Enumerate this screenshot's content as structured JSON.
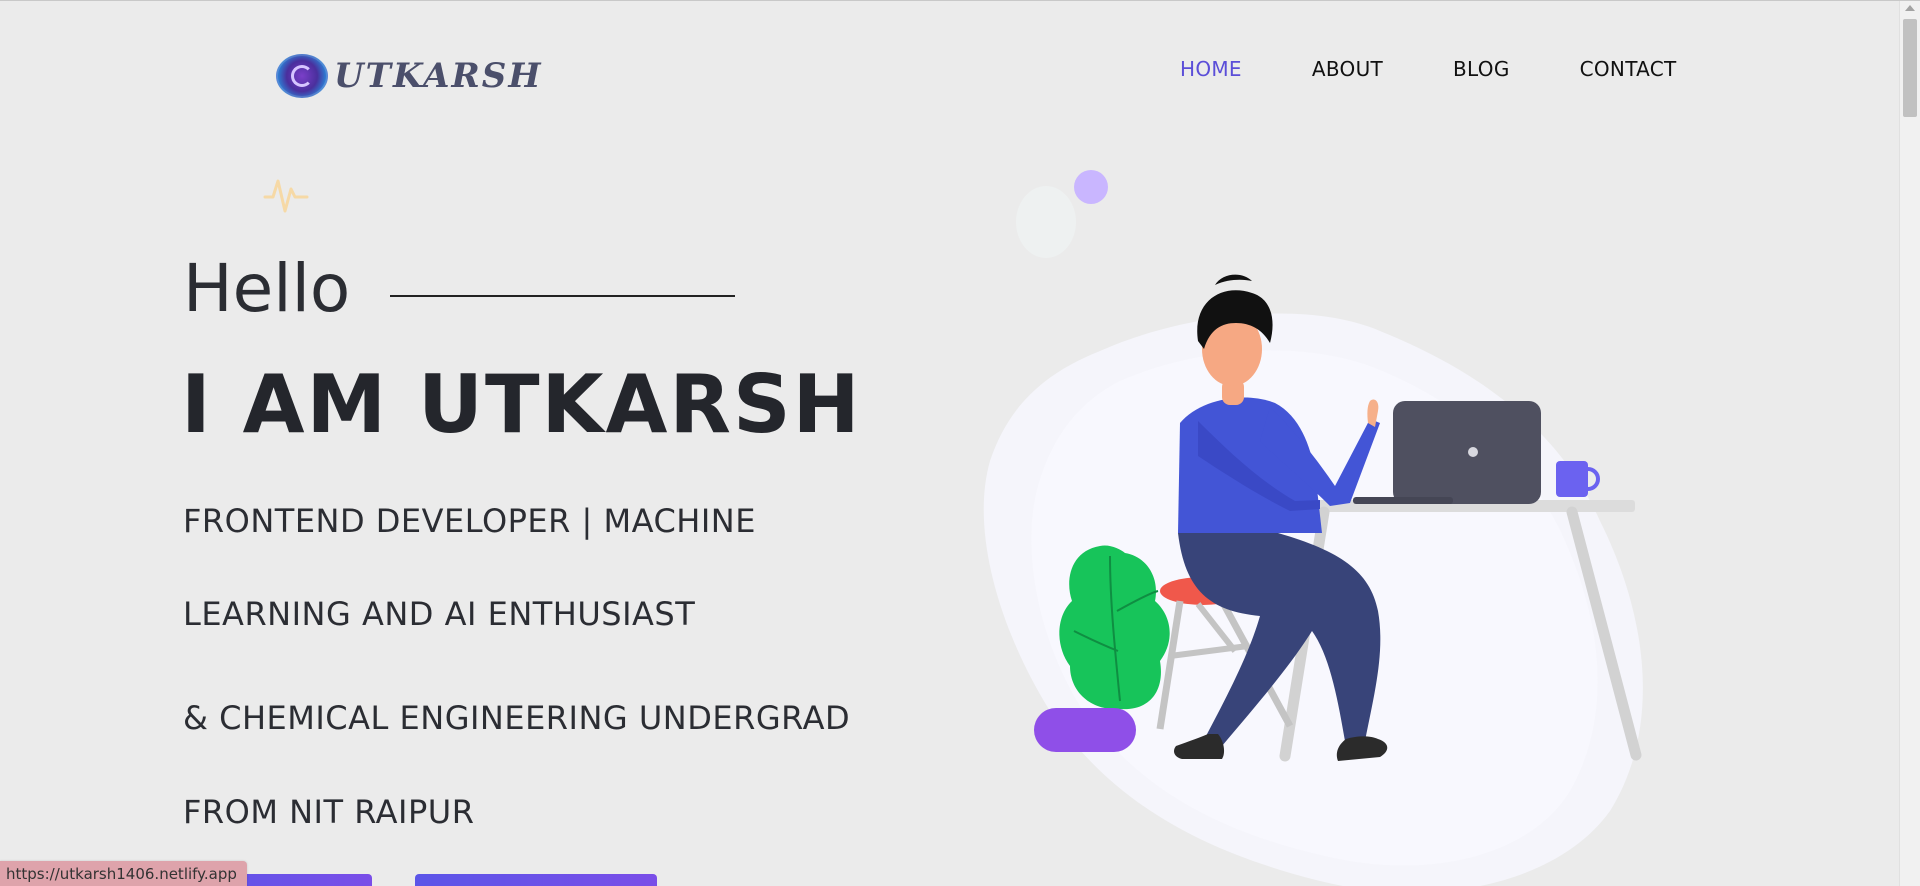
{
  "header": {
    "logo_text": "UTKARSH",
    "nav": [
      {
        "label": "HOME",
        "active": true
      },
      {
        "label": "ABOUT",
        "active": false
      },
      {
        "label": "BLOG",
        "active": false
      },
      {
        "label": "CONTACT",
        "active": false
      }
    ]
  },
  "hero": {
    "greeting": "Hello",
    "headline": "I AM UTKARSH",
    "tagline_lines": [
      "FRONTEND DEVELOPER | MACHINE",
      "LEARNING AND AI ENTHUSIAST",
      "& CHEMICAL ENGINEERING UNDERGRAD",
      "FROM NIT RAIPUR"
    ]
  },
  "status_bar": {
    "url": "https://utkarsh1406.netlify.app"
  },
  "colors": {
    "accent": "#5b4ed8",
    "background": "#ebebeb",
    "text_dark": "#24262c",
    "shirt": "#4355d6",
    "pants": "#384479",
    "plant": "#17c45a",
    "pot": "#8f4fe8",
    "laptop": "#4f5060"
  },
  "icons": [
    "logo-swirl-icon",
    "pulse-icon",
    "scroll-up-arrow-icon"
  ]
}
